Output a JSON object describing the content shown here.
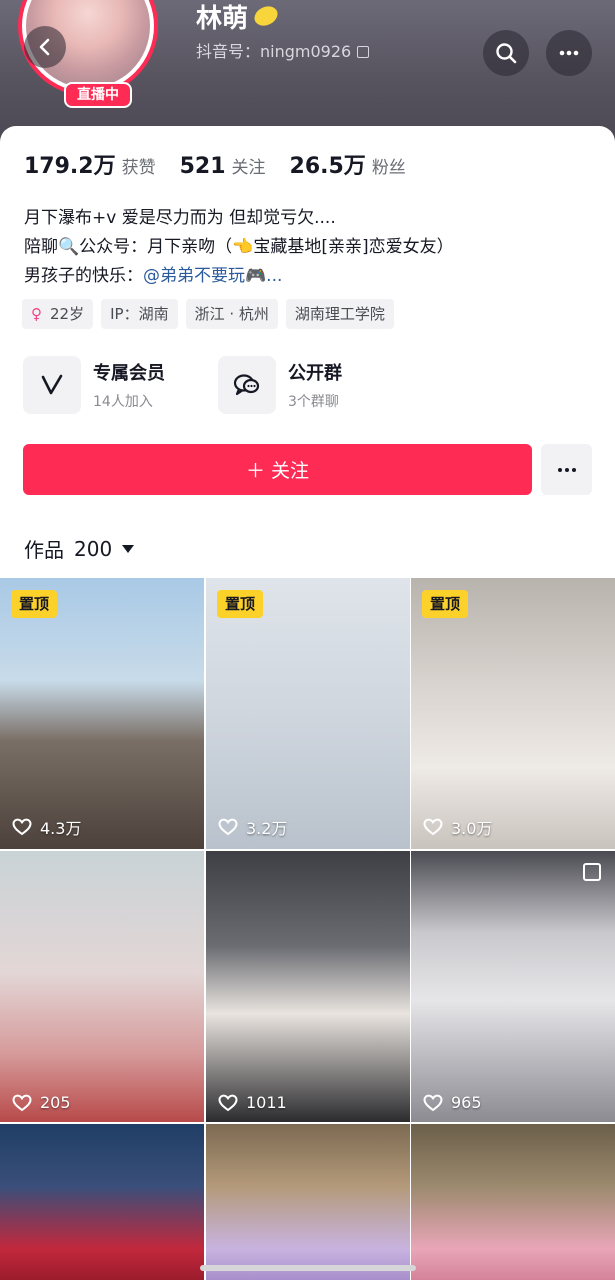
{
  "profile": {
    "nickname": "林萌",
    "douyin_id": "抖音号：ningm0926",
    "live_badge": "直播中"
  },
  "stats": [
    {
      "value": "179.2万",
      "label": "获赞"
    },
    {
      "value": "521",
      "label": "关注"
    },
    {
      "value": "26.5万",
      "label": "粉丝"
    }
  ],
  "bio": {
    "line1": "月下瀑布+v 爱是尽力而为 但却觉亏欠....",
    "line2": "陪聊🔍公众号：月下亲吻（👈宝藏基地[亲亲]恋爱女友）",
    "line3_prefix": "男孩子的快乐：",
    "line3_mention": "@弟弟不要玩🎮..."
  },
  "tags": {
    "age": "22岁",
    "ip": "IP：湖南",
    "location": "浙江 · 杭州",
    "school": "湖南理工学院"
  },
  "features": {
    "membership_title": "专属会员",
    "membership_sub": "14人加入",
    "group_title": "公开群",
    "group_sub": "3个群聊"
  },
  "actions": {
    "follow_label": "＋ 关注"
  },
  "works": {
    "tab_label": "作品",
    "count": "200"
  },
  "videos": [
    {
      "pinned_label": "置顶",
      "likes": "4.3万"
    },
    {
      "pinned_label": "置顶",
      "likes": "3.2万"
    },
    {
      "pinned_label": "置顶",
      "likes": "3.0万"
    },
    {
      "likes": "205"
    },
    {
      "likes": "1011"
    },
    {
      "likes": "965"
    },
    {},
    {},
    {}
  ],
  "colors": {
    "brand_red": "#fe2c55",
    "pin_yellow": "#fcd12a",
    "mention_blue": "#2b5b9c"
  }
}
